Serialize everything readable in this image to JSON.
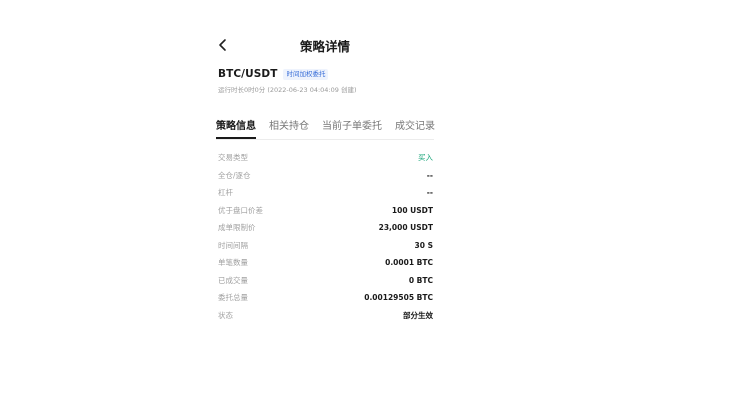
{
  "header": {
    "title": "策略详情",
    "back_icon": "chevron-left-icon"
  },
  "strategy": {
    "pair": "BTC/USDT",
    "tag": "时间加权委托",
    "runtime": "运行时长0时0分 (2022-06-23 04:04:09 创建)"
  },
  "tabs": [
    {
      "label": "策略信息",
      "active": true
    },
    {
      "label": "相关持仓",
      "active": false
    },
    {
      "label": "当前子单委托",
      "active": false
    },
    {
      "label": "成交记录",
      "active": false
    }
  ],
  "details": [
    {
      "label": "交易类型",
      "value": "买入",
      "color": "#19a57a"
    },
    {
      "label": "全仓/逐仓",
      "value": "--"
    },
    {
      "label": "杠杆",
      "value": "--"
    },
    {
      "label": "优于盘口价差",
      "value": "100 USDT"
    },
    {
      "label": "成单限制价",
      "value": "23,000 USDT"
    },
    {
      "label": "时间间隔",
      "value": "30 S"
    },
    {
      "label": "单笔数量",
      "value": "0.0001 BTC"
    },
    {
      "label": "已成交量",
      "value": "0 BTC"
    },
    {
      "label": "委托总量",
      "value": "0.00129505 BTC"
    },
    {
      "label": "状态",
      "value": "部分生效"
    }
  ]
}
